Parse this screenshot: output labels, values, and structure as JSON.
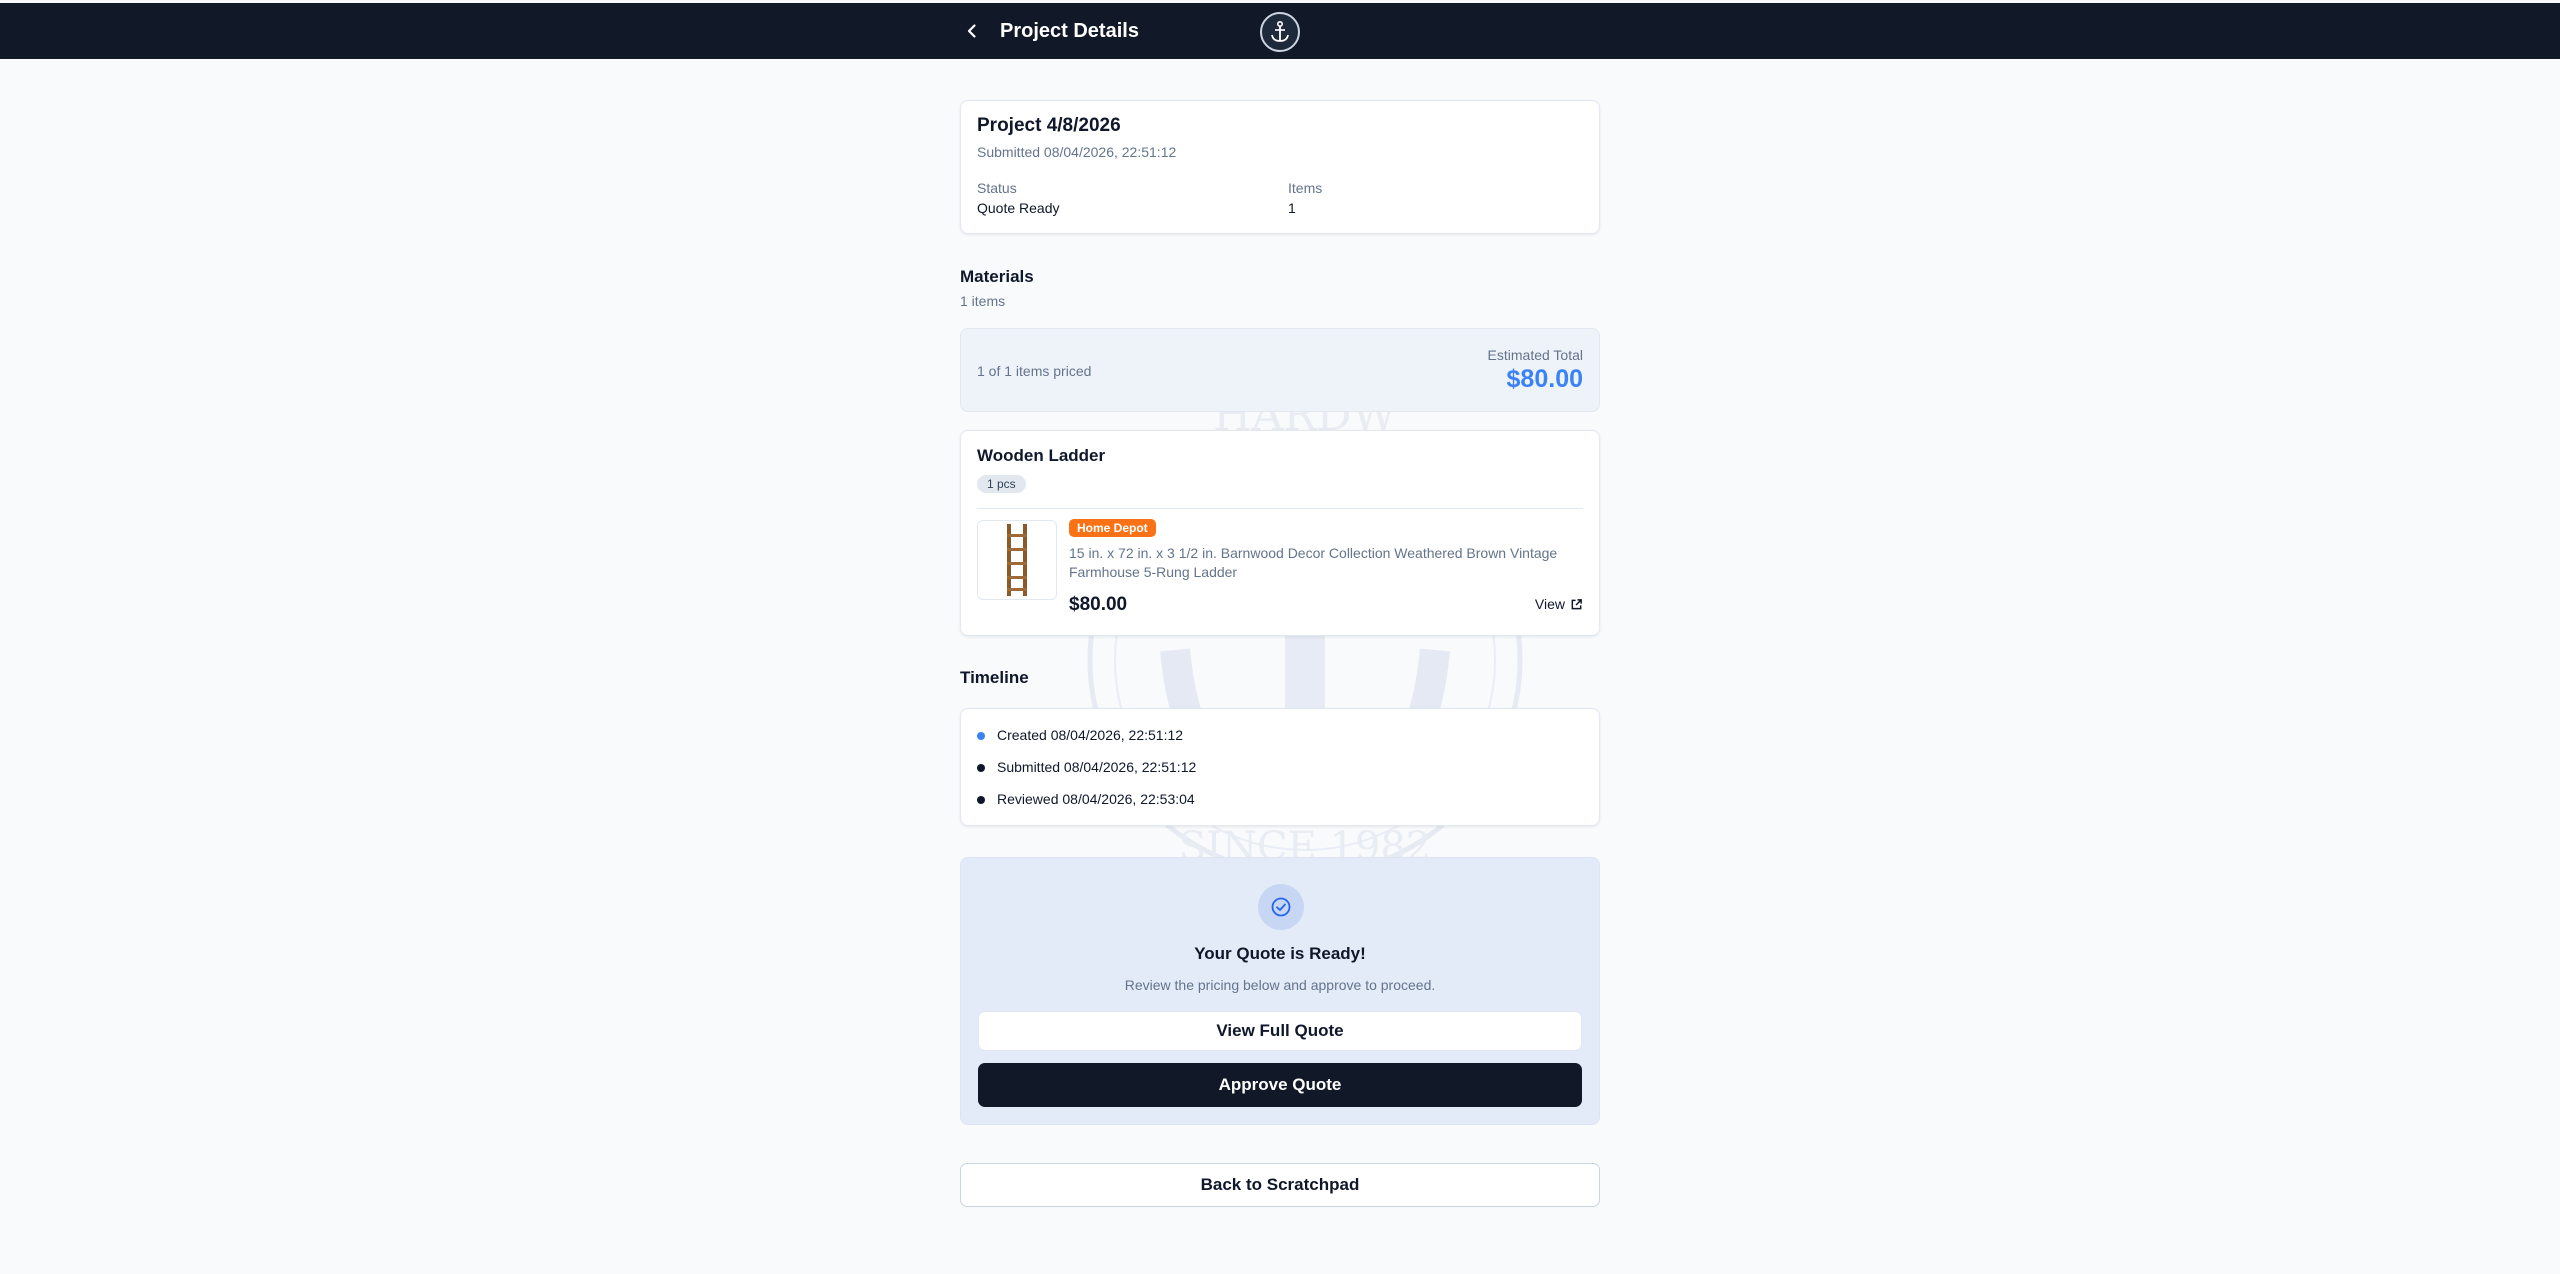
{
  "header": {
    "title": "Project Details"
  },
  "project": {
    "name": "Project 4/8/2026",
    "submitted": "Submitted 08/04/2026, 22:51:12",
    "status_label": "Status",
    "status_value": "Quote Ready",
    "items_label": "Items",
    "items_value": "1"
  },
  "materials": {
    "title": "Materials",
    "count": "1 items",
    "priced_text": "1 of 1 items priced",
    "estimated_label": "Estimated Total",
    "estimated_value": "$80.00"
  },
  "item": {
    "name": "Wooden Ladder",
    "qty": "1 pcs",
    "store": "Home Depot",
    "description": "15 in. x 72 in. x 3 1/2 in. Barnwood Decor Collection Weathered Brown Vintage Farmhouse 5-Rung Ladder",
    "price": "$80.00",
    "view_label": "View"
  },
  "timeline": {
    "title": "Timeline",
    "events": [
      {
        "text": "Created 08/04/2026, 22:51:12",
        "color": "#3b82f6"
      },
      {
        "text": "Submitted 08/04/2026, 22:51:12",
        "color": "#0f172a"
      },
      {
        "text": "Reviewed 08/04/2026, 22:53:04",
        "color": "#0f172a"
      }
    ]
  },
  "quote": {
    "title": "Your Quote is Ready!",
    "subtitle": "Review the pricing below and approve to proceed.",
    "view_button": "View Full Quote",
    "approve_button": "Approve Quote"
  },
  "footer": {
    "back_button": "Back to Scratchpad"
  },
  "colors": {
    "accent": "#3b82f6",
    "dark": "#111827",
    "store_badge": "#f97316",
    "quote_bg": "#e3ebf8"
  },
  "watermark": {
    "top_text": "HARDW",
    "bottom_text": "SINCE 1982"
  }
}
